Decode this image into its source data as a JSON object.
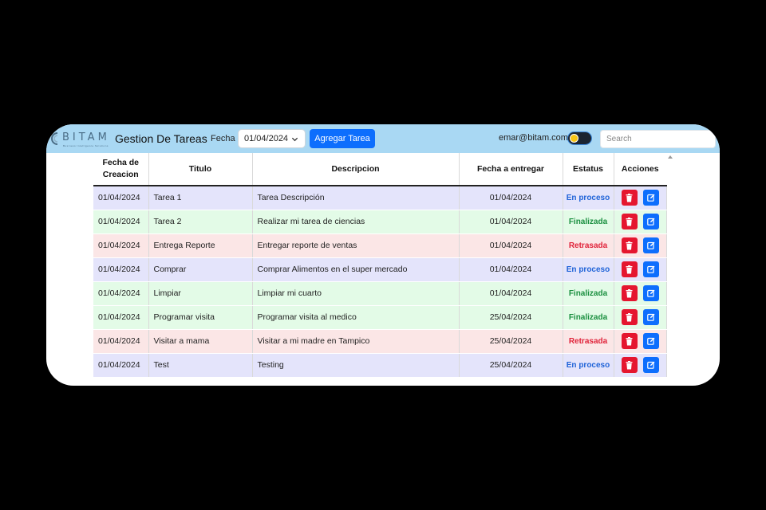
{
  "header": {
    "logo_text": "BITAM",
    "logo_subtext": "Business Intelligence Solutions",
    "title": "Gestion De Tareas",
    "fecha_label": "Fecha",
    "date_value": "01/04/2024",
    "add_button": "Agregar Tarea",
    "email": "emar@bitam.com",
    "search_placeholder": "Search"
  },
  "table": {
    "columns": [
      "Fecha de Creacion",
      "Titulo",
      "Descripcion",
      "Fecha a entregar",
      "Estatus",
      "Acciones"
    ],
    "rows": [
      {
        "created": "01/04/2024",
        "title": "Tarea 1",
        "description": "Tarea Descripción",
        "due": "01/04/2024",
        "status": "En proceso",
        "kind": "proceso"
      },
      {
        "created": "01/04/2024",
        "title": "Tarea 2",
        "description": "Realizar mi tarea de ciencias",
        "due": "01/04/2024",
        "status": "Finalizada",
        "kind": "final"
      },
      {
        "created": "01/04/2024",
        "title": "Entrega Reporte",
        "description": "Entregar reporte de ventas",
        "due": "01/04/2024",
        "status": "Retrasada",
        "kind": "retra"
      },
      {
        "created": "01/04/2024",
        "title": "Comprar",
        "description": "Comprar Alimentos en el super mercado",
        "due": "01/04/2024",
        "status": "En proceso",
        "kind": "proceso"
      },
      {
        "created": "01/04/2024",
        "title": "Limpiar",
        "description": "Limpiar mi cuarto",
        "due": "01/04/2024",
        "status": "Finalizada",
        "kind": "final"
      },
      {
        "created": "01/04/2024",
        "title": "Programar visita",
        "description": "Programar visita al medico",
        "due": "25/04/2024",
        "status": "Finalizada",
        "kind": "final"
      },
      {
        "created": "01/04/2024",
        "title": "Visitar a mama",
        "description": "Visitar a mi madre en Tampico",
        "due": "25/04/2024",
        "status": "Retrasada",
        "kind": "retra"
      },
      {
        "created": "01/04/2024",
        "title": "Test",
        "description": "Testing",
        "due": "25/04/2024",
        "status": "En proceso",
        "kind": "proceso"
      }
    ]
  },
  "colors": {
    "navbar": "#a9d8f3",
    "primary": "#0d6efd",
    "danger": "#e5162f",
    "row_proceso": "#e4e4fb",
    "row_final": "#e3fbe7",
    "row_retra": "#fbe6e6"
  },
  "icons": {
    "delete": "trash-icon",
    "edit": "edit-icon",
    "date_chevron": "chevron-down-icon",
    "theme_toggle": "sun-icon"
  }
}
